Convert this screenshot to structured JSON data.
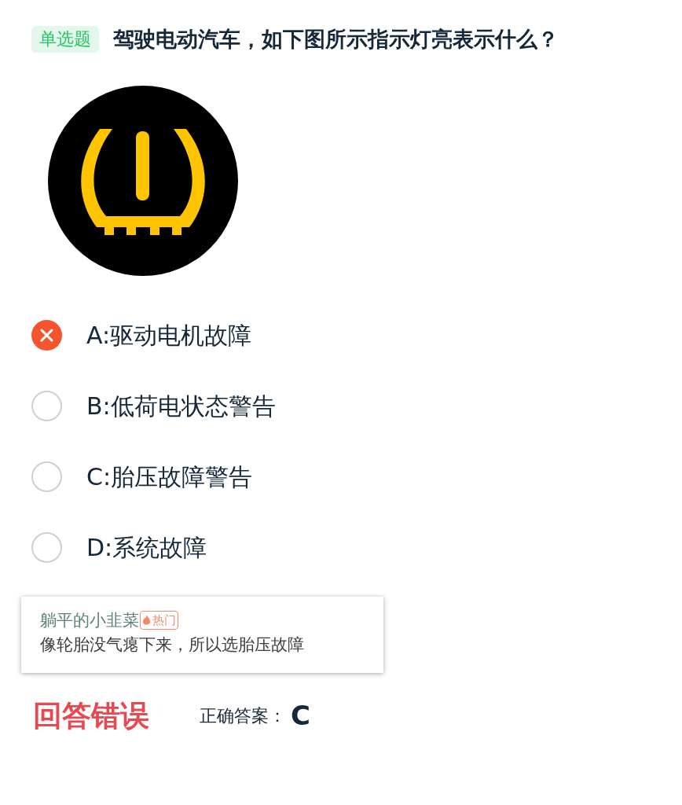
{
  "question": {
    "type_badge": "单选题",
    "text": "驾驶电动汽车，如下图所示指示灯亮表示什么？"
  },
  "options": [
    {
      "text": "A:驱动电机故障",
      "selected": true
    },
    {
      "text": "B:低荷电状态警告",
      "selected": false
    },
    {
      "text": "C:胎压故障警告",
      "selected": false
    },
    {
      "text": "D:系统故障",
      "selected": false
    }
  ],
  "comment": {
    "user": "躺平的小韭菜",
    "badge": "热门",
    "text": "像轮胎没气瘪下来，所以选胎压故障"
  },
  "result": {
    "verdict": "回答错误",
    "answer_label": "正确答案：",
    "answer": "C"
  }
}
